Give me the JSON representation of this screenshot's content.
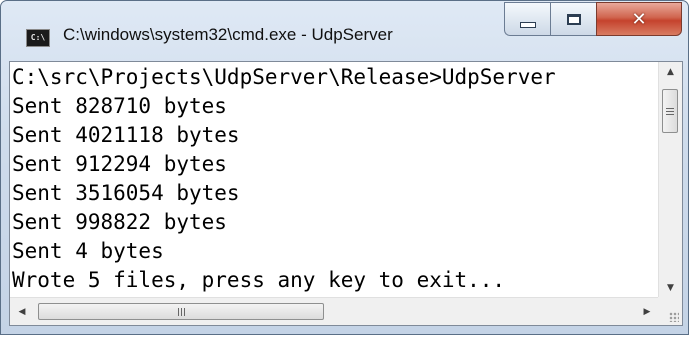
{
  "window": {
    "title": "C:\\windows\\system32\\cmd.exe - UdpServer",
    "icon_text": "C:\\"
  },
  "controls": {
    "minimize": "minimize-icon",
    "maximize": "maximize-icon",
    "close": "close-icon"
  },
  "console": {
    "lines": [
      "C:\\src\\Projects\\UdpServer\\Release>UdpServer",
      "Sent 828710 bytes",
      "Sent 4021118 bytes",
      "Sent 912294 bytes",
      "Sent 3516054 bytes",
      "Sent 998822 bytes",
      "Sent 4 bytes",
      "Wrote 5 files, press any key to exit..."
    ]
  },
  "colors": {
    "title_bar": "#cfdcec",
    "close_button": "#c5432d",
    "console_background": "#ffffff",
    "console_text": "#000000"
  }
}
